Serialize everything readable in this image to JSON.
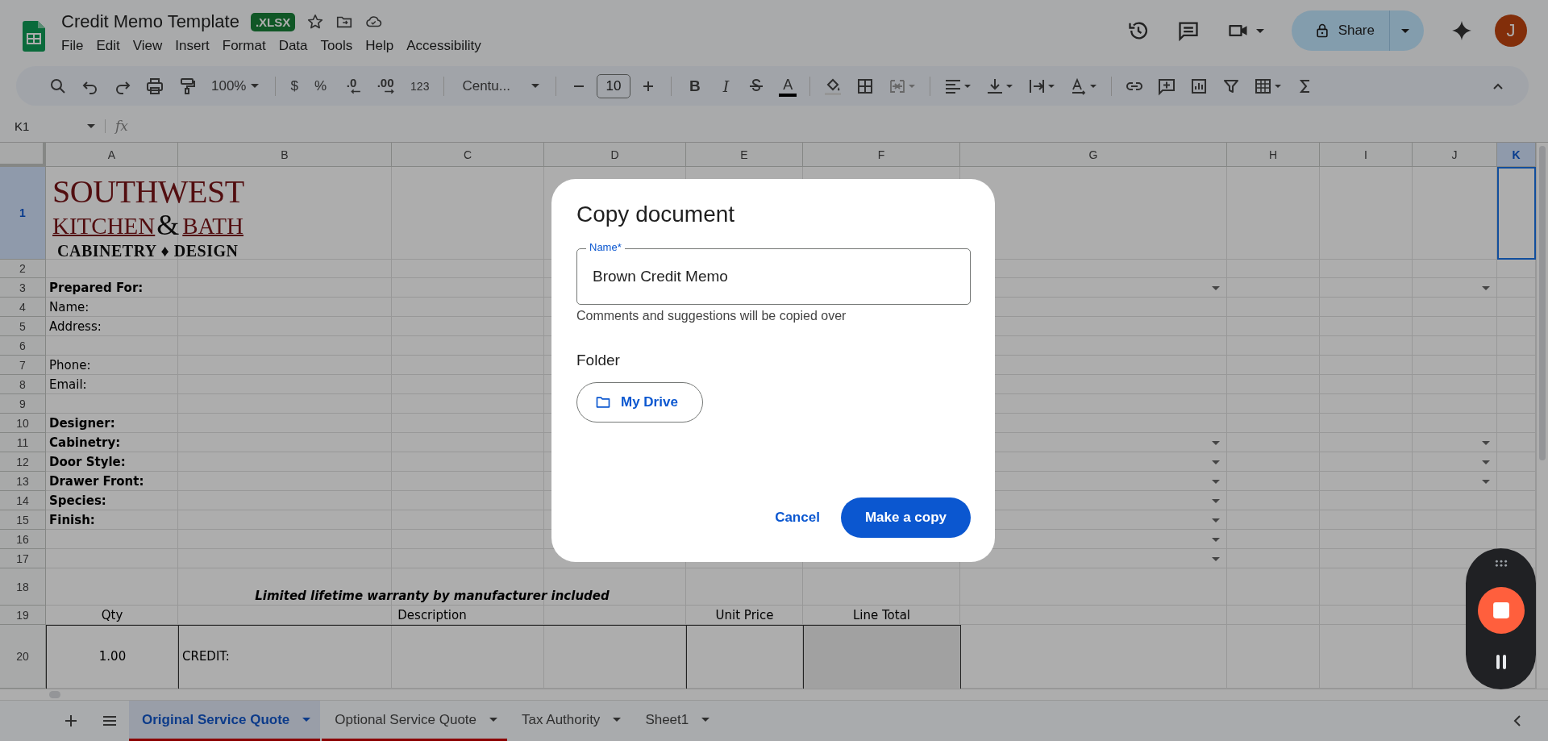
{
  "app": {
    "title": "Credit Memo Template",
    "file_badge": ".XLSX",
    "menu": [
      "File",
      "Edit",
      "View",
      "Insert",
      "Format",
      "Data",
      "Tools",
      "Help",
      "Accessibility"
    ],
    "share": "Share",
    "avatar": "J"
  },
  "toolbar": {
    "zoom": "100%",
    "currency": "$",
    "percent": "%",
    "decrease_decimal": ".0",
    "increase_decimal": ".00",
    "number_format": "123",
    "font": "Centu...",
    "font_size": "10",
    "bold": "B",
    "italic": "I",
    "text_color": "A"
  },
  "formula_bar": {
    "cell_ref": "K1",
    "fx": "fx"
  },
  "columns": [
    {
      "label": "A",
      "selected": false
    },
    {
      "label": "B",
      "selected": false
    },
    {
      "label": "C",
      "selected": false
    },
    {
      "label": "D",
      "selected": false
    },
    {
      "label": "E",
      "selected": false
    },
    {
      "label": "F",
      "selected": false
    },
    {
      "label": "G",
      "selected": false
    },
    {
      "label": "H",
      "selected": false
    },
    {
      "label": "I",
      "selected": false
    },
    {
      "label": "J",
      "selected": false
    },
    {
      "label": "K",
      "selected": true
    }
  ],
  "rows": [
    {
      "number": "1",
      "kind": "logo",
      "selected": true,
      "cells": {
        "A-C": {
          "kind": "logo",
          "name": "SOUTHWEST",
          "left": "KITCHEN",
          "ampersand": "&",
          "right": "BATH",
          "tagline": "CABINETRY ♦ DESIGN"
        }
      }
    },
    {
      "number": "2",
      "kind": "short",
      "selected": false,
      "cells": {}
    },
    {
      "number": "3",
      "kind": "normal",
      "selected": false,
      "dropdowns": {
        "G": true,
        "J": true
      },
      "cells": {
        "A": {
          "kind": "label",
          "text": "Prepared For:"
        }
      }
    },
    {
      "number": "4",
      "kind": "normal",
      "selected": false,
      "cells": {
        "A": {
          "kind": "plain",
          "text": "Name:"
        }
      }
    },
    {
      "number": "5",
      "kind": "normal",
      "selected": false,
      "cells": {
        "A": {
          "kind": "plain",
          "text": "Address:"
        }
      }
    },
    {
      "number": "6",
      "kind": "normal",
      "selected": false,
      "cells": {}
    },
    {
      "number": "7",
      "kind": "normal",
      "selected": false,
      "cells": {
        "A": {
          "kind": "plain",
          "text": "Phone:"
        }
      }
    },
    {
      "number": "8",
      "kind": "normal",
      "selected": false,
      "cells": {
        "A": {
          "kind": "plain",
          "text": "Email:"
        }
      }
    },
    {
      "number": "9",
      "kind": "normal",
      "selected": false,
      "cells": {}
    },
    {
      "number": "10",
      "kind": "normal",
      "selected": false,
      "cells": {
        "A": {
          "kind": "label",
          "text": "Designer:"
        }
      }
    },
    {
      "number": "11",
      "kind": "normal",
      "selected": false,
      "dropdowns": {
        "G": true,
        "J": true
      },
      "cells": {
        "A": {
          "kind": "label",
          "text": "Cabinetry:"
        }
      }
    },
    {
      "number": "12",
      "kind": "normal",
      "selected": false,
      "dropdowns": {
        "G": true,
        "J": true
      },
      "cells": {
        "A": {
          "kind": "label",
          "text": "Door Style:"
        }
      }
    },
    {
      "number": "13",
      "kind": "normal",
      "selected": false,
      "dropdowns": {
        "G": true,
        "J": true
      },
      "cells": {
        "A": {
          "kind": "label",
          "text": "Drawer Front:"
        }
      }
    },
    {
      "number": "14",
      "kind": "normal",
      "selected": false,
      "dropdowns": {
        "G": true
      },
      "cells": {
        "A": {
          "kind": "label",
          "text": "Species:"
        }
      }
    },
    {
      "number": "15",
      "kind": "normal",
      "selected": false,
      "dropdowns": {
        "G": true
      },
      "cells": {
        "A": {
          "kind": "label",
          "text": "Finish:"
        }
      }
    },
    {
      "number": "16",
      "kind": "normal",
      "selected": false,
      "dropdowns": {
        "G": true
      },
      "cells": {}
    },
    {
      "number": "17",
      "kind": "normal",
      "selected": false,
      "dropdowns": {
        "G": true
      },
      "cells": {}
    },
    {
      "number": "18",
      "kind": "tall",
      "selected": false,
      "cells": {
        "B-D": {
          "kind": "note",
          "text": "Limited lifetime warranty by manufacturer included"
        }
      }
    },
    {
      "number": "19",
      "kind": "normal",
      "selected": false,
      "cells": {
        "A": {
          "kind": "header",
          "text": "Qty"
        },
        "B-D": {
          "kind": "header",
          "text": "Description"
        },
        "E": {
          "kind": "header",
          "text": "Unit Price"
        },
        "F": {
          "kind": "header",
          "text": "Line Total"
        }
      }
    },
    {
      "number": "20",
      "kind": "item",
      "selected": false,
      "cells": {
        "A": {
          "kind": "qty",
          "text": "1.00"
        },
        "B-D": {
          "kind": "desc",
          "text": "CREDIT:"
        },
        "E": {
          "kind": "box"
        },
        "F": {
          "kind": "total"
        }
      }
    }
  ],
  "sheet_tabs": [
    {
      "label": "Original Service Quote",
      "selected": true,
      "color": "#8b0000"
    },
    {
      "label": "Optional Service Quote",
      "selected": false,
      "color": "#8b0000"
    },
    {
      "label": "Tax Authority",
      "selected": false
    },
    {
      "label": "Sheet1",
      "selected": false
    }
  ],
  "dialog": {
    "title": "Copy document",
    "name_label": "Name*",
    "name_value": "Brown Credit Memo",
    "helper": "Comments and suggestions will be copied over",
    "folder_heading": "Folder",
    "folder": "My Drive",
    "cancel": "Cancel",
    "confirm": "Make a copy"
  }
}
